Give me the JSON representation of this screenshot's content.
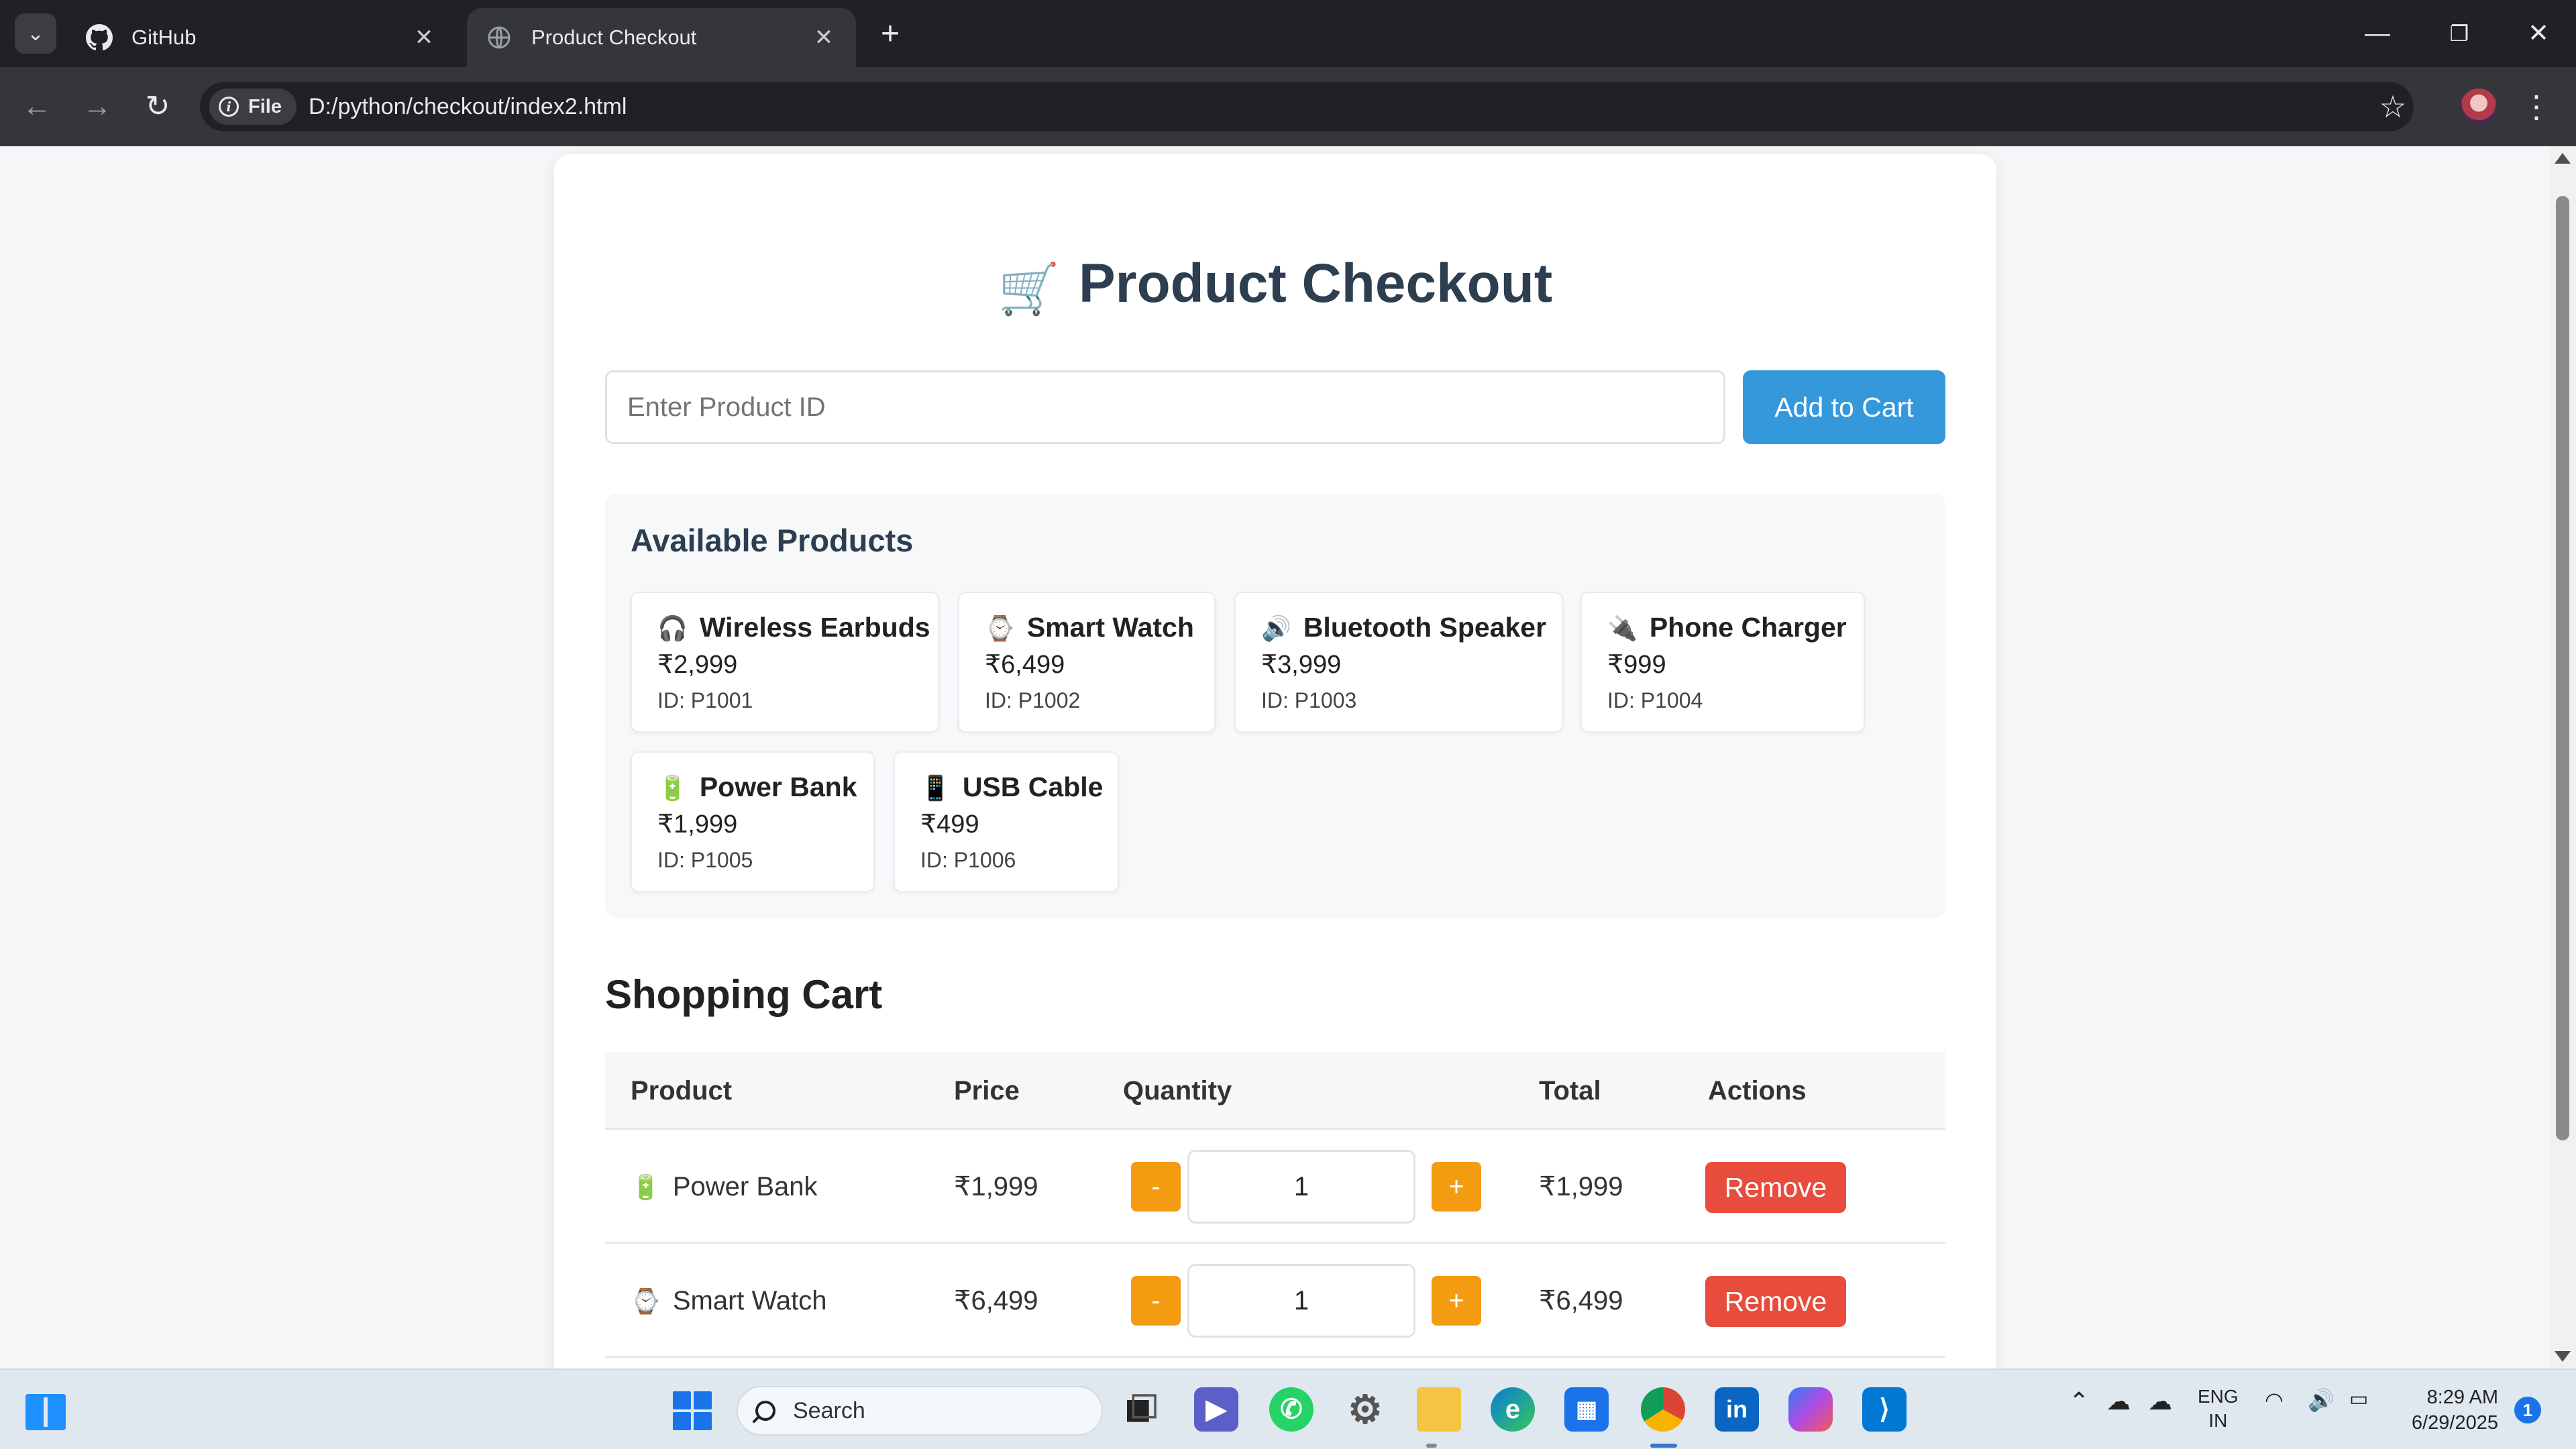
{
  "browser": {
    "tabs": [
      {
        "title": "GitHub",
        "icon": "github-icon"
      },
      {
        "title": "Product Checkout",
        "icon": "globe-icon"
      }
    ],
    "file_chip": "File",
    "url": "D:/python/checkout/index2.html"
  },
  "page": {
    "title": "Product Checkout",
    "title_icon": "🛒",
    "product_id_placeholder": "Enter Product ID",
    "add_button": "Add to Cart",
    "available_products_heading": "Available Products",
    "products": [
      {
        "emoji": "🎧",
        "name": "Wireless Earbuds",
        "price": "₹2,999",
        "id": "ID: P1001"
      },
      {
        "emoji": "⌚",
        "name": "Smart Watch",
        "price": "₹6,499",
        "id": "ID: P1002"
      },
      {
        "emoji": "🔊",
        "name": "Bluetooth Speaker",
        "price": "₹3,999",
        "id": "ID: P1003"
      },
      {
        "emoji": "🔌",
        "name": "Phone Charger",
        "price": "₹999",
        "id": "ID: P1004"
      },
      {
        "emoji": "🔋",
        "name": "Power Bank",
        "price": "₹1,999",
        "id": "ID: P1005"
      },
      {
        "emoji": "📱",
        "name": "USB Cable",
        "price": "₹499",
        "id": "ID: P1006"
      }
    ],
    "cart_heading": "Shopping Cart",
    "cart_columns": [
      "Product",
      "Price",
      "Quantity",
      "Total",
      "Actions"
    ],
    "cart_rows": [
      {
        "emoji": "🔋",
        "product": "Power Bank",
        "price": "₹1,999",
        "quantity": "1",
        "total": "₹1,999"
      },
      {
        "emoji": "⌚",
        "product": "Smart Watch",
        "price": "₹6,499",
        "quantity": "1",
        "total": "₹6,499"
      }
    ],
    "decrement_label": "-",
    "increment_label": "+",
    "remove_label": "Remove"
  },
  "taskbar": {
    "search_label": "Search",
    "language": "ENG",
    "region": "IN",
    "time": "8:29 AM",
    "date": "6/29/2025",
    "notification_count": "1"
  },
  "colors": {
    "primary_button": "#3498db",
    "quantity_button": "#f39c12",
    "remove_button": "#e74c3c",
    "heading_text": "#2c3e50"
  }
}
